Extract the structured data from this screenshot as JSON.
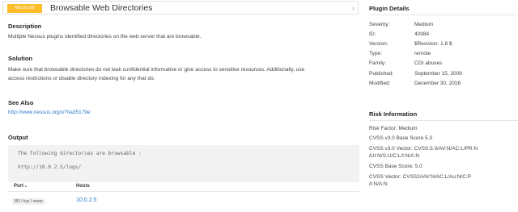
{
  "header": {
    "severity_badge": "MEDIUM",
    "title": "Browsable Web Directories",
    "chevron": "›"
  },
  "description": {
    "heading": "Description",
    "text": "Multiple Nessus plugins identified directories on the web server that are browsable."
  },
  "solution": {
    "heading": "Solution",
    "line1": "Make sure that browsable directories do not leak confidential informative or give access to sensitive resources. Additionally, use",
    "line2": "access restrictions or disable directory indexing for any that do."
  },
  "see_also": {
    "heading": "See Also",
    "link": "http://www.nessus.org/u?0a35179e"
  },
  "output": {
    "heading": "Output",
    "line1": "The following directories are browsable :",
    "line2": "http://10.0.2.5/logs/",
    "table": {
      "port_header": "Port",
      "port_sort_icon": "▴",
      "hosts_header": "Hosts",
      "rows": [
        {
          "port": "80 / tcp / www",
          "host": "10.0.2.5"
        }
      ]
    }
  },
  "plugin_details": {
    "heading": "Plugin Details",
    "rows": [
      {
        "label": "Severity:",
        "value": "Medium"
      },
      {
        "label": "ID:",
        "value": "40984"
      },
      {
        "label": "Version:",
        "value": "$Revision: 1.8 $"
      },
      {
        "label": "Type:",
        "value": "remote"
      },
      {
        "label": "Family:",
        "value": "CGI abuses"
      },
      {
        "label": "Published:",
        "value": "September 15, 2009"
      },
      {
        "label": "Modified:",
        "value": "December 30, 2016"
      }
    ]
  },
  "risk_information": {
    "heading": "Risk Information",
    "risk_factor": "Risk Factor: Medium",
    "cvss3_base": "CVSS v3.0 Base Score 5.3",
    "cvss3_vector_1": "CVSS v3.0 Vector: CVSS:3.0/AV:N/AC:L/PR:N",
    "cvss3_vector_2": "/UI:N/S:U/C:L/I:N/A:N",
    "cvss2_base": "CVSS Base Score: 5.0",
    "cvss2_vector_1": "CVSS Vector: CVSS2#AV:N/AC:L/Au:N/C:P",
    "cvss2_vector_2": "/I:N/A:N"
  },
  "colors": {
    "medium_badge": "#ffbc2b",
    "link": "#2a79c9"
  }
}
